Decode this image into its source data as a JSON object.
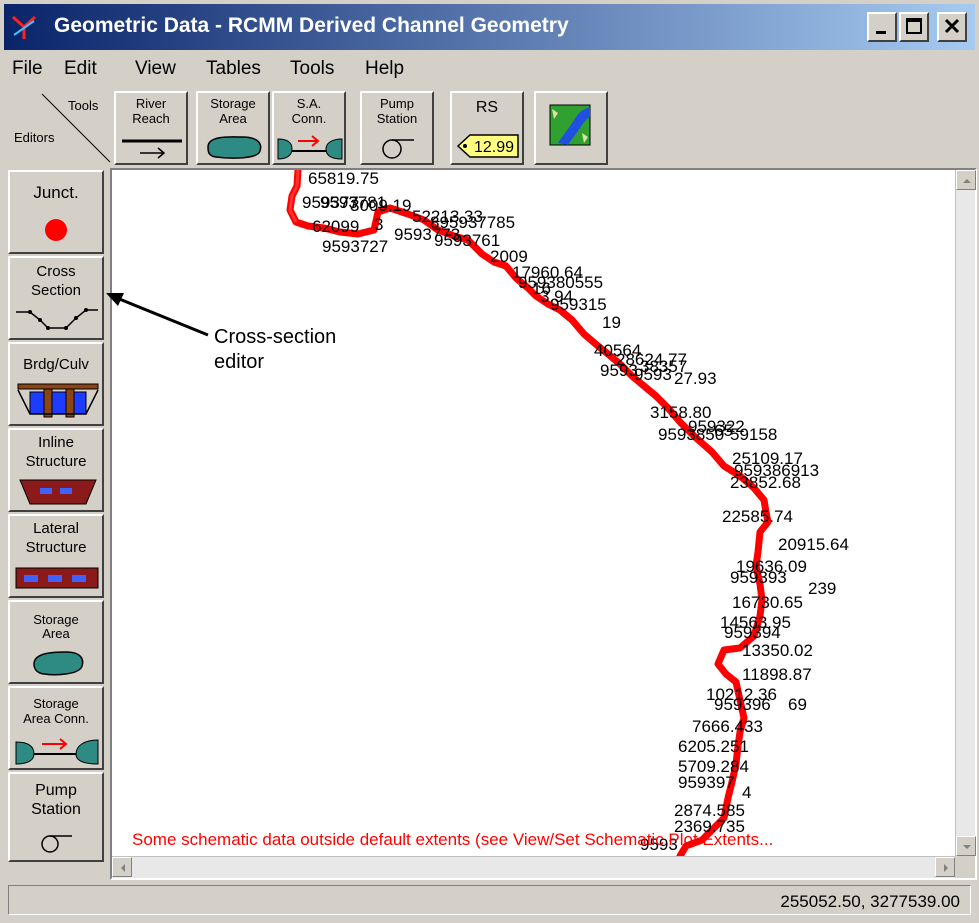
{
  "window": {
    "title": "Geometric Data - RCMM Derived Channel Geometry",
    "title_bar_color": "#0a246a",
    "controls": [
      "minimize-icon",
      "maximize-icon",
      "close-icon"
    ]
  },
  "menu": [
    "File",
    "Edit",
    "View",
    "Tables",
    "Tools",
    "Help"
  ],
  "toolbar": {
    "corner_top": "Tools",
    "corner_bottom": "Editors",
    "buttons": [
      {
        "line1": "River",
        "line2": "Reach",
        "icon": "river-reach-icon"
      },
      {
        "line1": "Storage",
        "line2": "Area",
        "icon": "storage-area-icon"
      },
      {
        "line1": "S.A.",
        "line2": "Conn.",
        "icon": "sa-connection-icon"
      },
      {
        "line1": "Pump",
        "line2": "Station",
        "icon": "pump-station-icon"
      },
      {
        "line1": "RS",
        "line2": "12.99",
        "icon": "river-station-tag-icon"
      },
      {
        "line1": "",
        "line2": "",
        "icon": "background-map-icon"
      }
    ]
  },
  "editors": [
    {
      "lines": [
        "Junct."
      ],
      "icon": "junction-icon"
    },
    {
      "lines": [
        "Cross",
        "Section"
      ],
      "icon": "cross-section-icon"
    },
    {
      "lines": [
        "Brdg/Culv"
      ],
      "icon": "bridge-culvert-icon"
    },
    {
      "lines": [
        "Inline",
        "Structure"
      ],
      "icon": "inline-structure-icon"
    },
    {
      "lines": [
        "Lateral",
        "Structure"
      ],
      "icon": "lateral-structure-icon"
    },
    {
      "lines": [
        "Storage",
        "Area"
      ],
      "icon": "storage-area-icon"
    },
    {
      "lines": [
        "Storage",
        "Area Conn."
      ],
      "icon": "storage-area-conn-icon"
    },
    {
      "lines": [
        "Pump",
        "Station"
      ],
      "icon": "pump-station-icon"
    }
  ],
  "annotation": {
    "line1": "Cross-section",
    "line2": "editor"
  },
  "schematic": {
    "reach_color": "#ff0000",
    "station_labels": [
      "65819.75",
      "959377",
      "9593781",
      "3009.19",
      "62099",
      "3",
      "52213.33",
      "895937785",
      "9593727",
      "9593773",
      "9593761",
      "2009",
      "17960.64",
      "959380555",
      "16",
      "3.94",
      "959315",
      "19",
      "40564",
      "28624.77",
      "9593",
      "38357",
      "9593",
      "27.93",
      "3158.80",
      "9593850",
      "959322",
      "65",
      "59158",
      "25109.17",
      "959386913",
      "23852.68",
      "22585.74",
      "20915.64",
      "19636.09",
      "959393",
      "16730.65",
      "239",
      "14563.95",
      "959394",
      "13350.02",
      "11898.87",
      "10212.36",
      "959396",
      "69",
      "7666.433",
      "6205.251",
      "5709.284",
      "959397",
      "4",
      "2874.585",
      "2369.735",
      "9593"
    ],
    "warning": "Some schematic data outside default extents (see View/Set Schematic Plot Extents..."
  },
  "status": {
    "coordinates": "255052.50, 3277539.00"
  }
}
